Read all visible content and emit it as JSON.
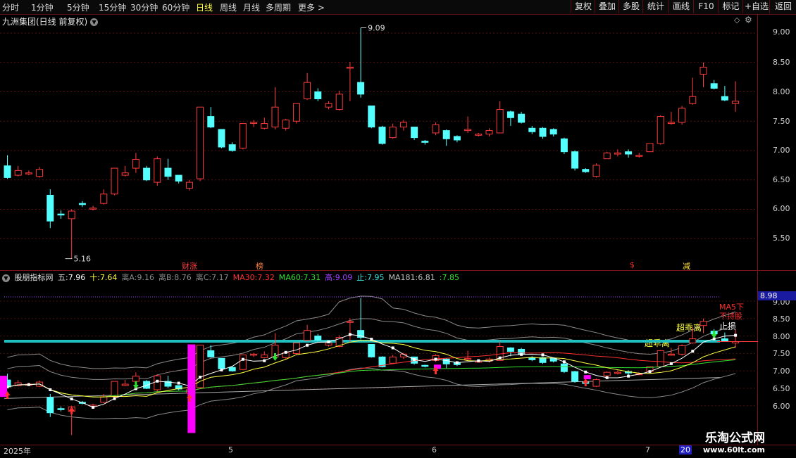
{
  "toolbar": {
    "periods": [
      "分时",
      "1分钟",
      "5分钟",
      "15分钟",
      "30分钟",
      "60分钟",
      "日线",
      "周线",
      "月线",
      "多周期",
      "更多 >"
    ],
    "active_period": "日线",
    "buttons": [
      "复权",
      "叠加",
      "多股",
      "统计",
      "画线",
      "F10",
      "标记",
      "+自选",
      "返回"
    ]
  },
  "main": {
    "title": "九洲集团(日线 前复权)",
    "price_ticks": [
      "9.00",
      "8.50",
      "8.00",
      "7.50",
      "7.00",
      "6.50",
      "6.00",
      "5.50"
    ],
    "high_label": "9.09",
    "low_label": "5.16",
    "events": [
      {
        "text": "财涨",
        "color": "#ff4040"
      },
      {
        "text": "榜",
        "color": "#ff8040"
      },
      {
        "text": "$",
        "color": "#ff3030"
      },
      {
        "text": "减",
        "color": "#ffe040"
      }
    ]
  },
  "indicator": {
    "name": "股朋指标网",
    "values": [
      {
        "label": "五:",
        "value": "7.96",
        "color": "#ffffff"
      },
      {
        "label": "十:",
        "value": "7.64",
        "color": "#ffff40"
      },
      {
        "label": "离A:",
        "value": "9.16",
        "color": "#8a8a8a"
      },
      {
        "label": "离B:",
        "value": "8.76",
        "color": "#8a8a8a"
      },
      {
        "label": "离C:",
        "value": "7.17",
        "color": "#8a8a8a"
      },
      {
        "label": "MA30:",
        "value": "7.32",
        "color": "#ff3030"
      },
      {
        "label": "MA60:",
        "value": "7.31",
        "color": "#30e030"
      },
      {
        "label": "高:",
        "value": "9.09",
        "color": "#a040ff"
      },
      {
        "label": "止:",
        "value": "7.95",
        "color": "#40e0e0"
      },
      {
        "label": "MA181:",
        "value": "6.81",
        "color": "#c0c0c0"
      },
      {
        "label": ":",
        "value": "7.85",
        "color": "#30e030"
      }
    ],
    "price_ticks": [
      "9.00",
      "8.50",
      "8.00",
      "7.50",
      "7.00",
      "6.50",
      "6.00"
    ],
    "current_value": "8.98",
    "annotations": {
      "ma5_warn": "MA5下\n不持股",
      "chaolili_1": "超乖离",
      "chaolili_2": "超乖离",
      "stop_loss": "止损"
    }
  },
  "date_axis": {
    "labels": [
      "2025年",
      "5",
      "6",
      "7",
      "20"
    ]
  },
  "watermark": {
    "name": "乐淘公式网",
    "url": "www.60lt.com"
  },
  "colors": {
    "up": "#ff3c3c",
    "down": "#54ffff",
    "ma5": "#ffffff",
    "ma10": "#ffff40",
    "ma30": "#ff3030",
    "ma60": "#30e030",
    "band": "#8a8a8a",
    "stop_line": "#20c0c0",
    "magenta": "#ff00ff"
  },
  "candles": [
    [
      6.74,
      6.54,
      6.92,
      6.52
    ],
    [
      6.58,
      6.66,
      6.74,
      6.56
    ],
    [
      6.62,
      6.62,
      6.66,
      6.58
    ],
    [
      6.56,
      6.68,
      6.72,
      6.54
    ],
    [
      6.24,
      5.8,
      6.34,
      5.68
    ],
    [
      5.92,
      5.91,
      5.98,
      5.84
    ],
    [
      5.84,
      5.97,
      6.0,
      5.16
    ],
    [
      6.1,
      6.08,
      6.14,
      6.04
    ],
    [
      6.02,
      6.02,
      6.06,
      5.98
    ],
    [
      6.1,
      6.26,
      6.34,
      6.08
    ],
    [
      6.26,
      6.7,
      6.7,
      6.24
    ],
    [
      6.58,
      6.62,
      6.74,
      6.56
    ],
    [
      6.7,
      6.85,
      6.96,
      6.62
    ],
    [
      6.7,
      6.5,
      6.74,
      6.48
    ],
    [
      6.46,
      6.86,
      6.9,
      6.4
    ],
    [
      6.7,
      6.56,
      6.86,
      6.5
    ],
    [
      6.58,
      6.48,
      6.58,
      6.44
    ],
    [
      6.36,
      6.46,
      6.5,
      6.32
    ],
    [
      6.52,
      7.74,
      7.74,
      6.48
    ],
    [
      7.58,
      7.4,
      7.74,
      7.38
    ],
    [
      7.36,
      7.06,
      7.36,
      7.04
    ],
    [
      7.1,
      7.0,
      7.14,
      6.98
    ],
    [
      7.04,
      7.46,
      7.46,
      7.02
    ],
    [
      7.48,
      7.48,
      7.52,
      7.4
    ],
    [
      7.38,
      7.46,
      7.56,
      7.36
    ],
    [
      7.4,
      7.74,
      8.08,
      7.36
    ],
    [
      7.38,
      7.52,
      7.54,
      7.34
    ],
    [
      7.5,
      7.8,
      7.8,
      7.46
    ],
    [
      7.88,
      8.16,
      8.32,
      7.86
    ],
    [
      8.0,
      7.88,
      8.06,
      7.84
    ],
    [
      7.74,
      7.8,
      7.84,
      7.7
    ],
    [
      7.7,
      7.96,
      8.02,
      7.68
    ],
    [
      8.42,
      8.42,
      8.51,
      7.84
    ],
    [
      8.16,
      7.96,
      9.09,
      7.9
    ],
    [
      7.76,
      7.4,
      7.76,
      7.38
    ],
    [
      7.4,
      7.12,
      7.42,
      7.1
    ],
    [
      7.22,
      7.4,
      7.46,
      7.2
    ],
    [
      7.4,
      7.48,
      7.52,
      7.34
    ],
    [
      7.4,
      7.22,
      7.4,
      7.18
    ],
    [
      7.16,
      7.14,
      7.18,
      7.1
    ],
    [
      7.3,
      7.44,
      7.48,
      7.26
    ],
    [
      7.34,
      7.2,
      7.36,
      7.08
    ],
    [
      7.24,
      7.18,
      7.26,
      7.14
    ],
    [
      7.34,
      7.36,
      7.58,
      7.3
    ],
    [
      7.26,
      7.28,
      7.3,
      7.24
    ],
    [
      7.28,
      7.34,
      7.38,
      7.24
    ],
    [
      7.3,
      7.7,
      7.84,
      7.3
    ],
    [
      7.66,
      7.56,
      7.68,
      7.42
    ],
    [
      7.62,
      7.48,
      7.66,
      7.46
    ],
    [
      7.38,
      7.32,
      7.42,
      7.28
    ],
    [
      7.38,
      7.24,
      7.4,
      7.2
    ],
    [
      7.36,
      7.28,
      7.38,
      7.24
    ],
    [
      7.2,
      6.98,
      7.22,
      6.94
    ],
    [
      6.98,
      6.7,
      7.0,
      6.66
    ],
    [
      6.68,
      6.64,
      6.7,
      6.62
    ],
    [
      6.56,
      6.75,
      6.78,
      6.54
    ],
    [
      6.86,
      6.96,
      6.98,
      6.86
    ],
    [
      6.94,
      6.96,
      7.02,
      6.9
    ],
    [
      6.98,
      6.94,
      7.02,
      6.88
    ],
    [
      6.92,
      6.92,
      6.96,
      6.88
    ],
    [
      6.98,
      7.12,
      7.12,
      6.98
    ],
    [
      7.12,
      7.58,
      7.6,
      7.1
    ],
    [
      7.46,
      7.48,
      7.66,
      7.44
    ],
    [
      7.48,
      7.72,
      7.76,
      7.44
    ],
    [
      7.8,
      7.92,
      8.24,
      7.78
    ],
    [
      8.3,
      8.42,
      8.5,
      8.08
    ],
    [
      8.14,
      8.06,
      8.2,
      8.04
    ],
    [
      7.92,
      7.86,
      8.1,
      7.84
    ],
    [
      7.8,
      7.84,
      8.18,
      7.66
    ]
  ]
}
